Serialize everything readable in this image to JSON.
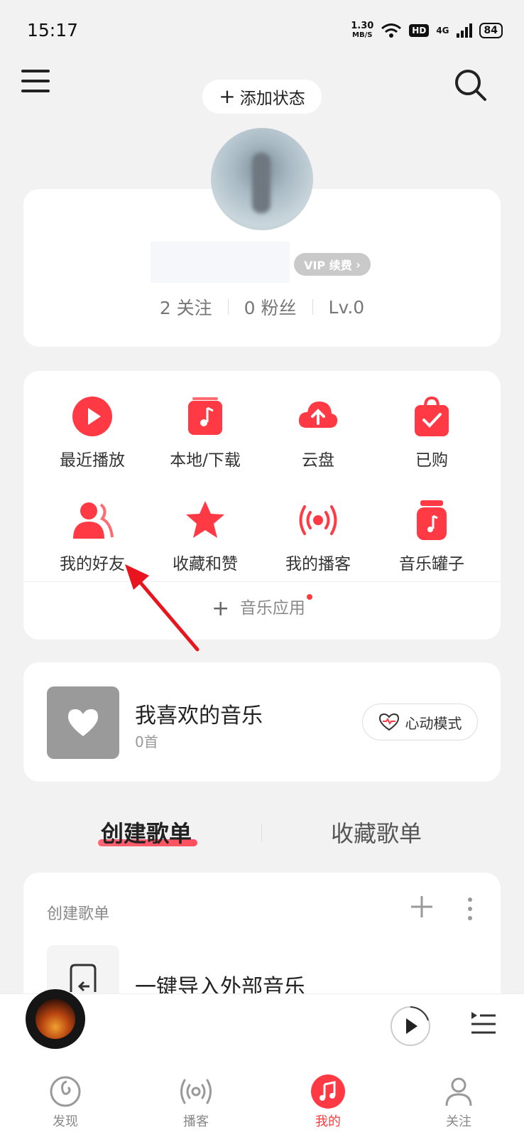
{
  "status_bar": {
    "time": "15:17",
    "net_speed_value": "1.30",
    "net_speed_unit": "MB/S",
    "hd": "HD",
    "signal": "4G",
    "battery": "84"
  },
  "header": {
    "add_status": "添加状态"
  },
  "profile": {
    "vip_badge": "VIP 续费",
    "follow": "2 关注",
    "fans": "0 粉丝",
    "level": "Lv.0"
  },
  "grid": {
    "items": [
      {
        "label": "最近播放",
        "icon": "play-circle-icon"
      },
      {
        "label": "本地/下载",
        "icon": "music-note-icon"
      },
      {
        "label": "云盘",
        "icon": "cloud-upload-icon"
      },
      {
        "label": "已购",
        "icon": "shopping-bag-icon"
      },
      {
        "label": "我的好友",
        "icon": "friends-icon"
      },
      {
        "label": "收藏和赞",
        "icon": "star-icon"
      },
      {
        "label": "我的播客",
        "icon": "podcast-icon"
      },
      {
        "label": "音乐罐子",
        "icon": "music-jar-icon"
      }
    ],
    "music_app": "音乐应用"
  },
  "liked": {
    "title": "我喜欢的音乐",
    "count": "0首",
    "heart_mode": "心动模式"
  },
  "tabs": {
    "create": "创建歌单",
    "collect": "收藏歌单"
  },
  "playlist": {
    "header": "创建歌单",
    "import_label": "一键导入外部音乐"
  },
  "nav": {
    "items": [
      {
        "label": "发现",
        "icon": "discover-icon"
      },
      {
        "label": "播客",
        "icon": "podcast-icon"
      },
      {
        "label": "我的",
        "icon": "music-note-icon"
      },
      {
        "label": "关注",
        "icon": "follow-icon"
      }
    ]
  },
  "colors": {
    "accent": "#ff3a3a",
    "background": "#f2f2f3"
  }
}
